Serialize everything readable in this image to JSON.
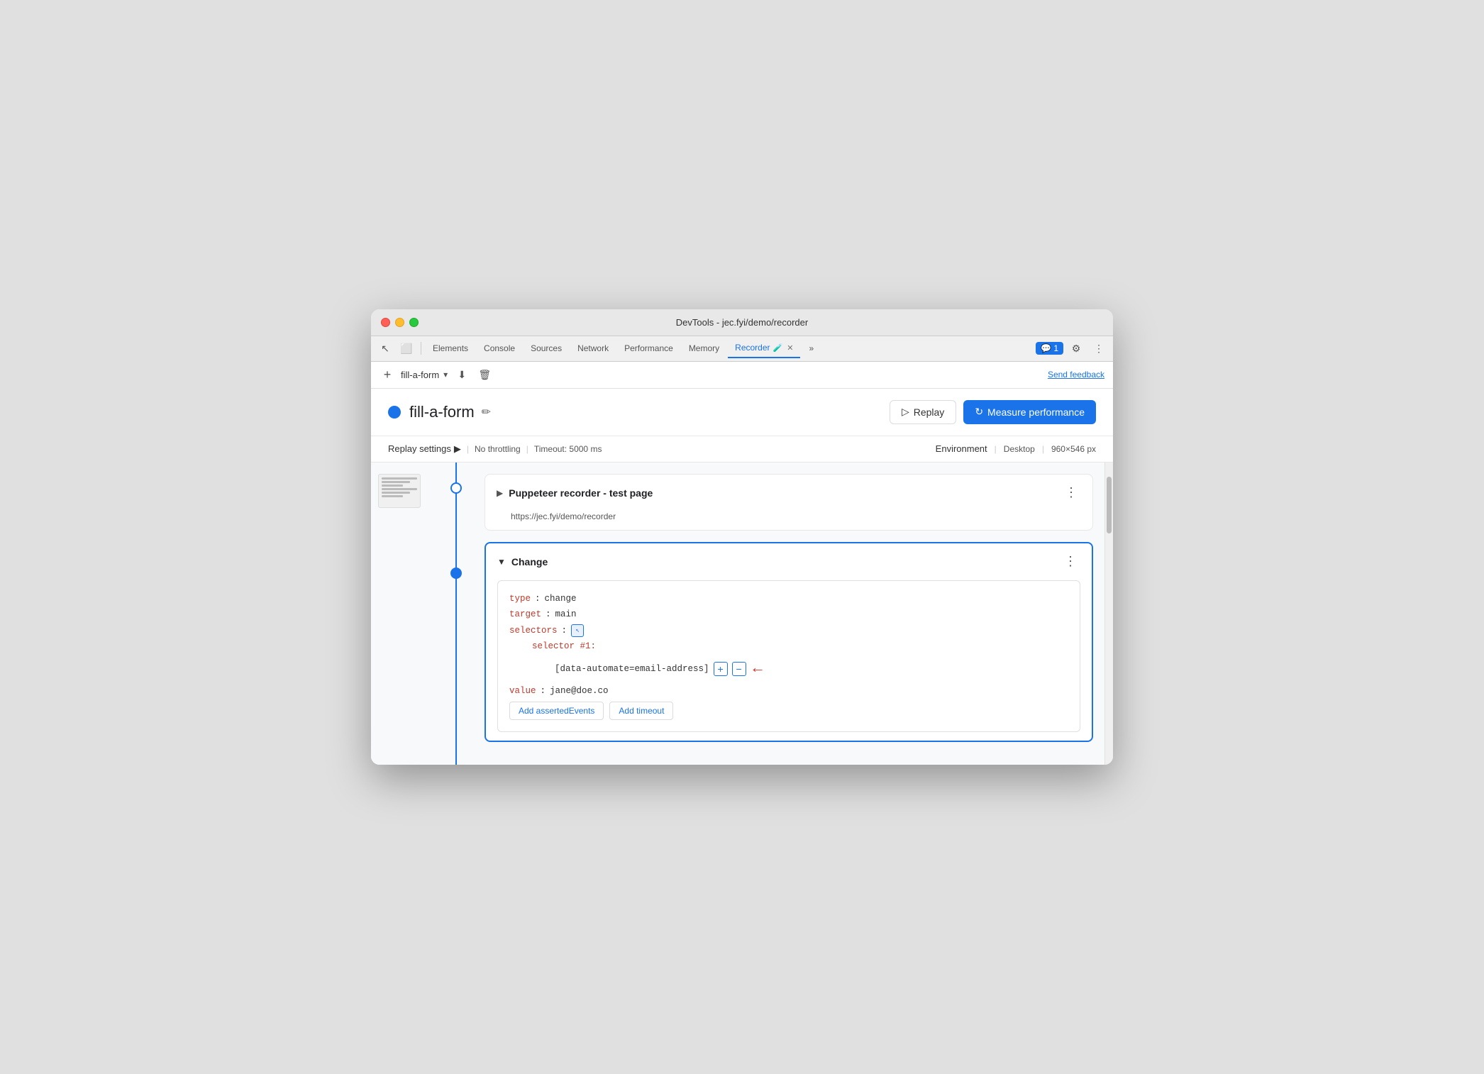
{
  "window": {
    "title": "DevTools - jec.fyi/demo/recorder"
  },
  "tabs": {
    "items": [
      {
        "label": "Elements",
        "active": false
      },
      {
        "label": "Console",
        "active": false
      },
      {
        "label": "Sources",
        "active": false
      },
      {
        "label": "Network",
        "active": false
      },
      {
        "label": "Performance",
        "active": false
      },
      {
        "label": "Memory",
        "active": false
      },
      {
        "label": "Recorder",
        "active": true
      },
      {
        "label": "»",
        "active": false
      }
    ],
    "chat_count": "1",
    "settings_icon": "⚙",
    "more_icon": "⋮"
  },
  "toolbar": {
    "add_icon": "+",
    "recording_name": "fill-a-form",
    "dropdown_icon": "▾",
    "download_icon": "⬇",
    "delete_icon": "🗑",
    "send_feedback": "Send feedback"
  },
  "header": {
    "dot_color": "#1a73e8",
    "title": "fill-a-form",
    "edit_icon": "✏",
    "replay_label": "Replay",
    "measure_label": "Measure performance",
    "replay_icon": "▷",
    "measure_icon": "↻"
  },
  "settings": {
    "label": "Replay settings",
    "arrow": "▶",
    "throttle": "No throttling",
    "timeout": "Timeout: 5000 ms",
    "env_label": "Environment",
    "env_desktop": "Desktop",
    "env_size": "960×546 px"
  },
  "steps": [
    {
      "id": "step-1",
      "type": "navigate",
      "title": "Puppeteer recorder - test page",
      "url": "https://jec.fyi/demo/recorder",
      "expanded": false,
      "dot_type": "outline"
    },
    {
      "id": "step-2",
      "type": "change",
      "title": "Change",
      "expanded": true,
      "dot_type": "filled",
      "code": {
        "type_key": "type",
        "type_val": "change",
        "target_key": "target",
        "target_val": "main",
        "selectors_key": "selectors",
        "selector_num_label": "selector #1:",
        "selector_value": "[data-automate=email-address]",
        "value_key": "value",
        "value_val": "jane@doe.co"
      },
      "actions": [
        {
          "label": "Add assertedEvents"
        },
        {
          "label": "Add timeout"
        }
      ]
    }
  ]
}
